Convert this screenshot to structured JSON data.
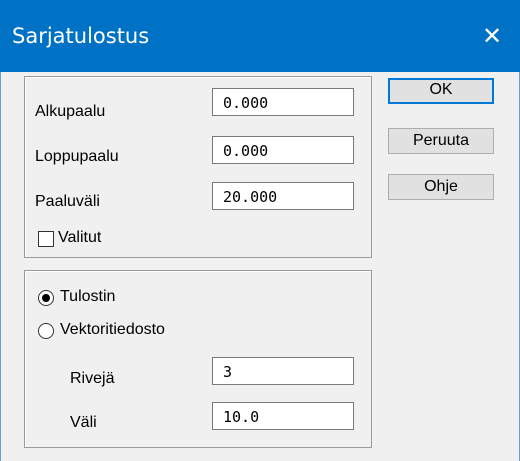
{
  "window": {
    "title": "Sarjatulostus",
    "close_glyph": "✕",
    "accent_color": "#0072c6"
  },
  "range_group": {
    "start_label": "Alkupaalu",
    "start_value": "0.000",
    "end_label": "Loppupaalu",
    "end_value": "0.000",
    "interval_label": "Paaluväli",
    "interval_value": "20.000",
    "selected_label": "Valitut",
    "selected_checked": false
  },
  "output_group": {
    "printer_label": "Tulostin",
    "printer_selected": true,
    "vector_label": "Vektoritiedosto",
    "vector_selected": false,
    "rows_label": "Rivejä",
    "rows_value": "3",
    "gap_label": "Väli",
    "gap_value": "10.0"
  },
  "buttons": {
    "ok": "OK",
    "cancel": "Peruuta",
    "help": "Ohje"
  },
  "icons": {
    "close": "close-icon"
  }
}
